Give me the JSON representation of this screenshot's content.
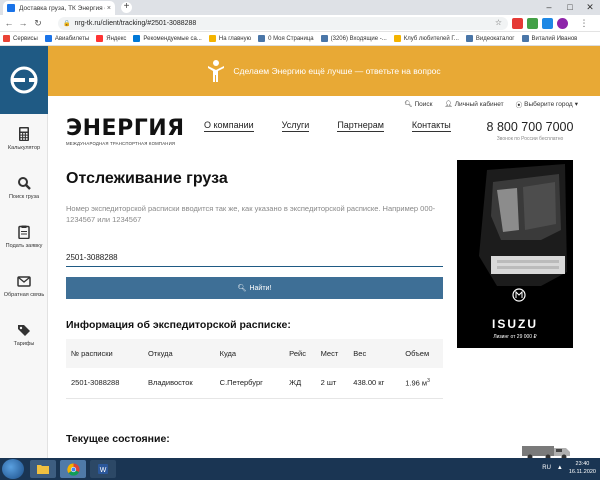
{
  "browser": {
    "tab_title": "Доставка груза, ТК Энергия отс",
    "tab_close": "×",
    "new_tab": "+",
    "url": "nrg-tk.ru/client/tracking/#2501-3088288",
    "win_min": "–",
    "win_max": "□",
    "win_close": "✕",
    "bookmarks": [
      {
        "label": "Сервисы",
        "color": "#ea4335"
      },
      {
        "label": "Авиабилеты",
        "color": "#1a73e8"
      },
      {
        "label": "Яндекс",
        "color": "#ff3333"
      },
      {
        "label": "Рекомендуемые са...",
        "color": "#0078d7"
      },
      {
        "label": "На главную",
        "color": "#f4b400"
      },
      {
        "label": "0 Моя Страница",
        "color": "#4a76a8"
      },
      {
        "label": "(3206) Входящие -...",
        "color": "#4a76a8"
      },
      {
        "label": "Клуб любителей Г...",
        "color": "#f4b400"
      },
      {
        "label": "Видеокаталог",
        "color": "#4a76a8"
      },
      {
        "label": "Виталий Иванов",
        "color": "#4a76a8"
      }
    ]
  },
  "sidebar": {
    "items": [
      {
        "label": "Калькулятор",
        "icon": "calculator-icon"
      },
      {
        "label": "Поиск груза",
        "icon": "search-icon"
      },
      {
        "label": "Подать заявку",
        "icon": "clipboard-icon"
      },
      {
        "label": "Обратная связь",
        "icon": "envelope-icon"
      },
      {
        "label": "Тарифы",
        "icon": "tags-icon"
      }
    ]
  },
  "banner": {
    "text": "Сделаем Энергию ещё лучше — ответьте на вопрос"
  },
  "toplinks": {
    "search": "Поиск",
    "cabinet": "Личный кабинет",
    "city": "Выберите город"
  },
  "brand": {
    "name": "ЭНЕРГИЯ",
    "tagline": "МЕЖДУНАРОДНАЯ ТРАНСПОРТНАЯ КОМПАНИЯ"
  },
  "nav": [
    "О компании",
    "Услуги",
    "Партнерам",
    "Контакты"
  ],
  "phone": {
    "number": "8 800 700 7000",
    "note": "Звонок по России бесплатно"
  },
  "tracking": {
    "title": "Отслеживание груза",
    "description": "Номер экспедиторской расписки вводится так же, как указано в экспедиторской расписке. Например 000-1234567 или 1234567",
    "input_value": "2501-3088288",
    "button_label": "Найти!"
  },
  "info": {
    "title": "Информация об экспедиторской расписке:",
    "headers": [
      "№ расписки",
      "Откуда",
      "Куда",
      "Рейс",
      "Мест",
      "Вес",
      "Объем"
    ],
    "row": [
      "2501-3088288",
      "Владивосток",
      "С.Петербург",
      "ЖД",
      "2 шт",
      "438.00 кг",
      "1.96 м"
    ],
    "volume_unit_sup": "3"
  },
  "current": {
    "title": "Текущее состояние:"
  },
  "ad": {
    "brand": "ISUZU",
    "price": "Лизинг от 29 000 ₽"
  },
  "taskbar": {
    "lang": "RU",
    "time": "23:40",
    "date": "16.11.2020"
  },
  "colors": {
    "banner": "#e8a935",
    "logo": "#1f5a84",
    "button": "#3e6f96"
  }
}
